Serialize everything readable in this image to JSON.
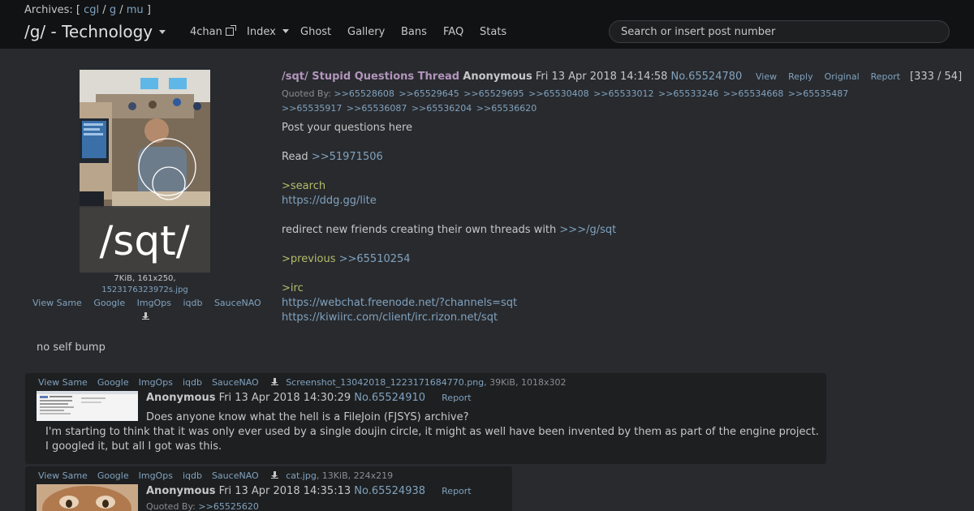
{
  "header": {
    "archives_prefix": "Archives: [",
    "archives": [
      "cgl",
      "g",
      "mu"
    ],
    "archives_sep": "/",
    "archives_suffix": "]",
    "board_title": "/g/ - Technology",
    "nav": [
      "4chan",
      "Index",
      "Ghost",
      "Gallery",
      "Bans",
      "FAQ",
      "Stats"
    ],
    "search_placeholder": "Search or insert post number"
  },
  "op": {
    "thumb_caption": "/sqt/",
    "file_info": "7KiB, 161x250,",
    "filename": "1523176323972s.jpg",
    "tools": [
      "View Same",
      "Google",
      "ImgOps",
      "iqdb",
      "SauceNAO"
    ],
    "subject": "/sqt/ Stupid Questions Thread",
    "name": "Anonymous",
    "date": "Fri 13 Apr 2018 14:14:58",
    "post_no": "No.65524780",
    "actions": [
      "View",
      "Reply",
      "Original",
      "Report"
    ],
    "counts": "[333 / 54]",
    "quoted_label": "Quoted By:",
    "quoted_by": [
      ">>65528608",
      ">>65529645",
      ">>65529695",
      ">>65530408",
      ">>65533012",
      ">>65533246",
      ">>65534668",
      ">>65535487",
      ">>65535917",
      ">>65536087",
      ">>65536204",
      ">>65536620"
    ],
    "body": {
      "l1": "Post your questions here",
      "l2_text": "Read ",
      "l2_link": ">>51971506",
      "l3": ">search",
      "l4": "https://ddg.gg/lite",
      "l5_text": "redirect new friends creating their own threads with ",
      "l5_link": ">>>/g/sqt",
      "l6_green": ">previous ",
      "l6_link": ">>65510254",
      "l7": ">irc",
      "l8": "https://webchat.freenode.net/?channels=sqt",
      "l9": "https://kiwiirc.com/client/irc.rizon.net/sqt"
    },
    "footer_note": "no self bump"
  },
  "replies": [
    {
      "tools": [
        "View Same",
        "Google",
        "ImgOps",
        "iqdb",
        "SauceNAO"
      ],
      "filename": "Screenshot_13042018_1223171684770.png",
      "file_meta": ", 39KiB, 1018x302",
      "name": "Anonymous",
      "date": "Fri 13 Apr 2018 14:30:29",
      "post_no": "No.65524910",
      "report": "Report",
      "lines": [
        "Does anyone know what the hell is a FileJoin (FJSYS) archive?",
        "I'm starting to think that it was only ever used by a single doujin circle, it might as well have been invented by them as part of the engine project.",
        "I googled it, but all I got was this."
      ]
    },
    {
      "tools": [
        "View Same",
        "Google",
        "ImgOps",
        "iqdb",
        "SauceNAO"
      ],
      "filename": "cat.jpg",
      "file_meta": ", 13KiB, 224x219",
      "name": "Anonymous",
      "date": "Fri 13 Apr 2018 14:35:13",
      "post_no": "No.65524938",
      "report": "Report",
      "quoted_label": "Quoted By:",
      "quoted_by": ">>65525620"
    }
  ],
  "colors": {
    "background": "#282a2e",
    "topbar": "#111214",
    "link": "#81a2be",
    "subject": "#b294bb",
    "greentext": "#b5bd68",
    "reply_bg": "#1d1f21"
  }
}
